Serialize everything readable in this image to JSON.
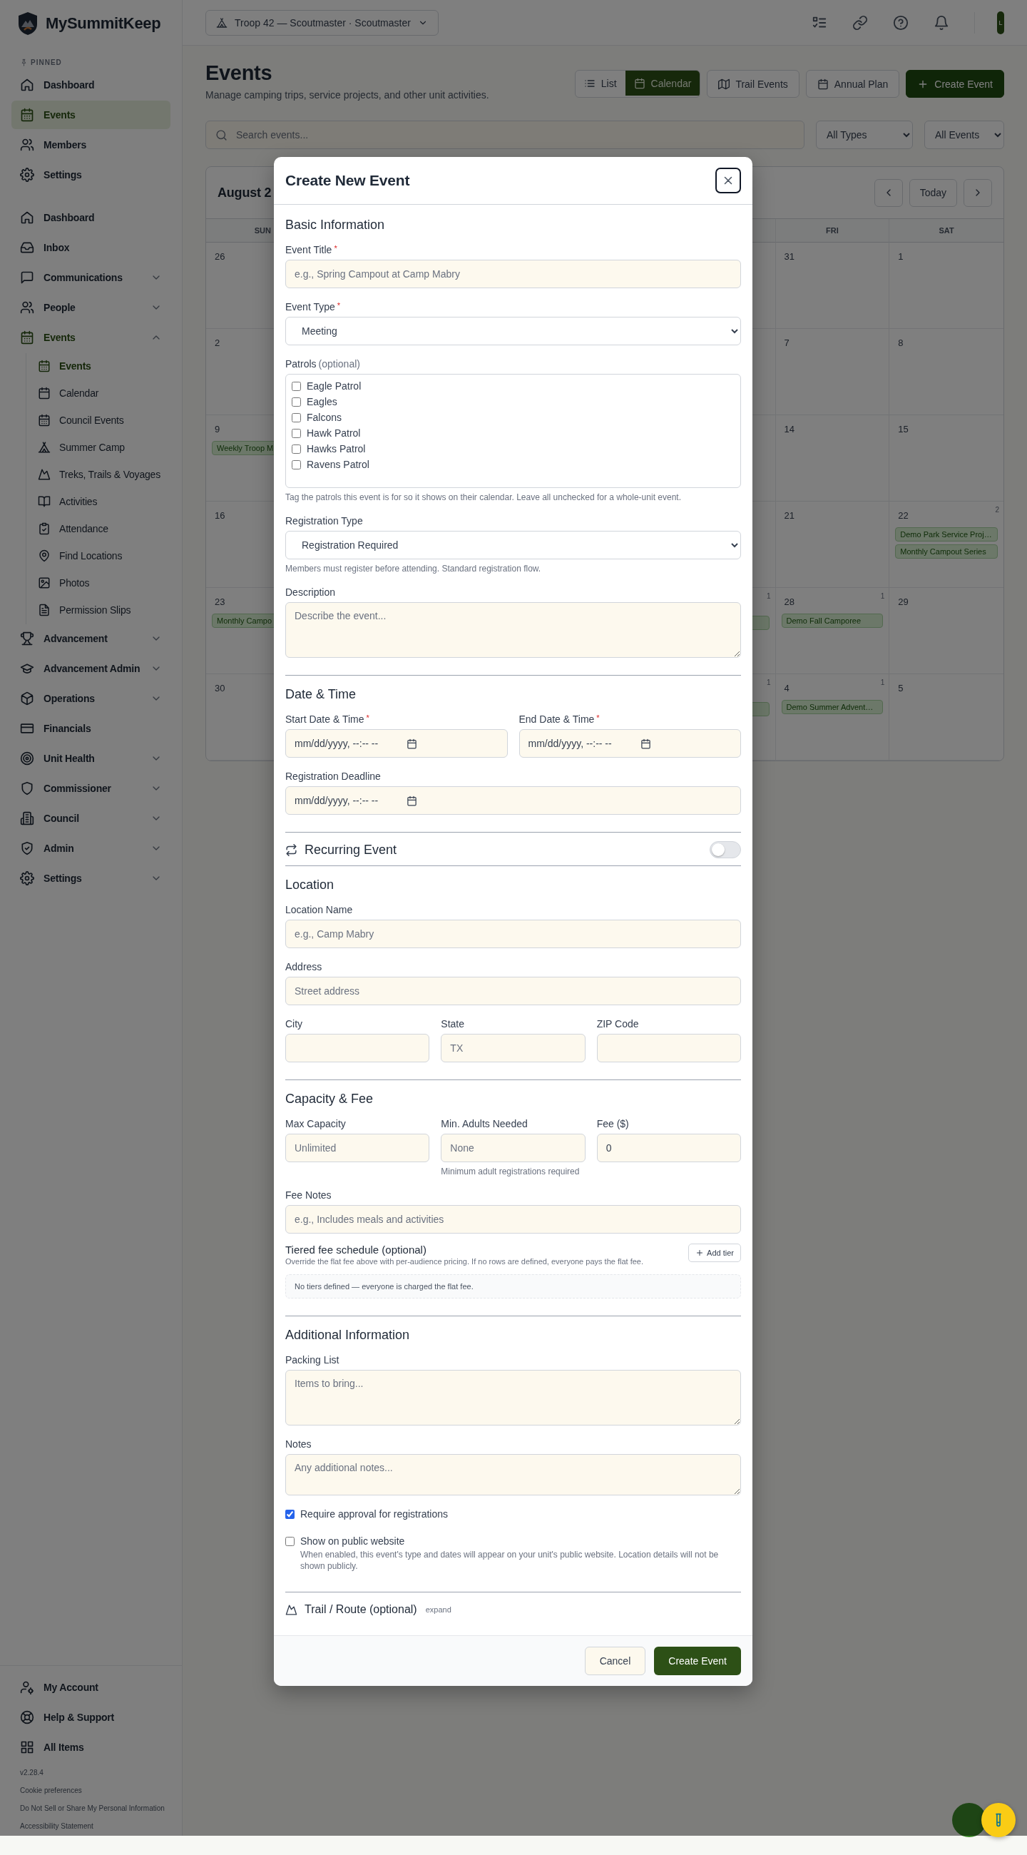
{
  "sidebar": {
    "brand": "MySummitKeep",
    "pinned_heading": "PINNED",
    "pinned": [
      {
        "label": "Dashboard",
        "selected": false
      },
      {
        "label": "Events",
        "selected": true
      },
      {
        "label": "Members",
        "selected": false
      },
      {
        "label": "Settings",
        "selected": false
      }
    ],
    "nav": [
      {
        "label": "Dashboard"
      },
      {
        "label": "Inbox"
      },
      {
        "label": "Communications",
        "expanded": false
      },
      {
        "label": "People",
        "expanded": false
      },
      {
        "label": "Events",
        "expanded": true,
        "children": [
          {
            "label": "Events",
            "selected": true
          },
          {
            "label": "Calendar",
            "selected": false
          },
          {
            "label": "Council Events",
            "selected": false
          },
          {
            "label": "Summer Camp",
            "selected": false
          },
          {
            "label": "Treks, Trails & Voyages",
            "selected": false
          },
          {
            "label": "Activities",
            "selected": false
          },
          {
            "label": "Attendance",
            "selected": false
          },
          {
            "label": "Find Locations",
            "selected": false
          },
          {
            "label": "Photos",
            "selected": false
          },
          {
            "label": "Permission Slips",
            "selected": false
          }
        ]
      },
      {
        "label": "Advancement",
        "expanded": false
      },
      {
        "label": "Advancement Admin",
        "expanded": false
      },
      {
        "label": "Operations",
        "expanded": false
      },
      {
        "label": "Financials"
      },
      {
        "label": "Unit Health",
        "expanded": false
      },
      {
        "label": "Commissioner",
        "expanded": false
      },
      {
        "label": "Council",
        "expanded": false
      },
      {
        "label": "Admin",
        "expanded": false
      },
      {
        "label": "Settings",
        "expanded": false
      }
    ],
    "footer_nav": [
      {
        "label": "My Account"
      },
      {
        "label": "Help & Support"
      },
      {
        "label": "All Items"
      }
    ],
    "version": "v2.28.4",
    "links": [
      "Cookie preferences",
      "Do Not Sell or Share My Personal Information",
      "Accessibility Statement"
    ]
  },
  "header": {
    "unit_selector": "Troop 42 — Scoutmaster · Scoutmaster",
    "avatar": "L"
  },
  "page": {
    "title": "Events",
    "subtitle": "Manage camping trips, service projects, and other unit activities.",
    "view_toggle": [
      {
        "label": "List",
        "selected": false
      },
      {
        "label": "Calendar",
        "selected": true
      }
    ],
    "buttons": [
      "Trail Events",
      "Annual Plan"
    ],
    "primary_button": "Create Event",
    "search": {
      "placeholder": "Search events..."
    },
    "filters": [
      "All Types",
      "All Events"
    ],
    "calendar": {
      "month_title": "August 2",
      "today_button": "Today",
      "weekdays": {
        "sun": "SUN",
        "fri": "FRI",
        "sat": "SAT"
      },
      "weeks": [
        {
          "sun": {
            "date": "26"
          },
          "fri": {
            "date": "31"
          },
          "sat": {
            "date": "1"
          }
        },
        {
          "sun": {
            "date": "2"
          },
          "fri": {
            "date": "7"
          },
          "sat": {
            "date": "8"
          }
        },
        {
          "sun": {
            "date": "9",
            "events": [
              {
                "kind": "event",
                "title": "Weekly Troop M"
              }
            ]
          },
          "fri": {
            "date": "14"
          },
          "sat": {
            "date": "15"
          }
        },
        {
          "sun": {
            "date": "16"
          },
          "fri": {
            "date": "21"
          },
          "sat": {
            "date": "22",
            "count": "2",
            "events": [
              {
                "kind": "event",
                "title": "Demo Park Service Proj…"
              },
              {
                "kind": "event",
                "title": "Monthly Campout Series"
              }
            ]
          }
        },
        {
          "sun": {
            "date": "23",
            "events": [
              {
                "kind": "event",
                "title": "Monthly Campo"
              }
            ]
          },
          "thu": {
            "count": "1",
            "events": [
              {
                "kind": "covered"
              }
            ]
          },
          "fri": {
            "date": "28",
            "count": "1",
            "events": [
              {
                "kind": "event",
                "title": "Demo Fall Camporee"
              }
            ]
          },
          "sat": {
            "date": "29"
          }
        },
        {
          "sun": {
            "date": "30"
          },
          "thu": {
            "count": "1",
            "events": [
              {
                "kind": "covered"
              }
            ]
          },
          "fri": {
            "date": "4",
            "count": "1",
            "events": [
              {
                "kind": "event",
                "title": "Demo Summer Advent…"
              }
            ]
          },
          "sat": {
            "date": "5"
          }
        }
      ]
    }
  },
  "modal": {
    "title": "Create New Event",
    "sections": [
      {
        "kind": "fields",
        "title": "Basic Information",
        "rows": [
          [
            {
              "kind": "text",
              "label": "Event Title",
              "required_mark": "*",
              "placeholder": "e.g., Spring Campout at Camp Mabry"
            }
          ],
          [
            {
              "kind": "select",
              "label": "Event Type",
              "required_mark": "*",
              "value": "Meeting"
            }
          ],
          [
            {
              "kind": "checklist",
              "label": "Patrols",
              "label_note": "(optional)",
              "options": [
                {
                  "label": "Eagle Patrol",
                  "checked": false
                },
                {
                  "label": "Eagles",
                  "checked": false
                },
                {
                  "label": "Falcons",
                  "checked": false
                },
                {
                  "label": "Hawk Patrol",
                  "checked": false
                },
                {
                  "label": "Hawks Patrol",
                  "checked": false
                },
                {
                  "label": "Ravens Patrol",
                  "checked": false
                }
              ],
              "hint": "Tag the patrols this event is for so it shows on their calendar. Leave all unchecked for a whole-unit event."
            }
          ],
          [
            {
              "kind": "select",
              "label": "Registration Type",
              "value": "Registration Required",
              "hint": "Members must register before attending. Standard registration flow."
            }
          ],
          [
            {
              "kind": "textarea",
              "label": "Description",
              "placeholder": "Describe the event..."
            }
          ]
        ]
      },
      {
        "kind": "fields",
        "title": "Date & Time",
        "rows": [
          [
            {
              "kind": "datetime",
              "label": "Start Date & Time",
              "required_mark": "*",
              "placeholder": "mm/dd/yyyy, --:-- --"
            },
            {
              "kind": "datetime",
              "label": "End Date & Time",
              "required_mark": "*",
              "placeholder": "mm/dd/yyyy, --:-- --"
            }
          ],
          [
            {
              "kind": "datetime",
              "label": "Registration Deadline",
              "placeholder": "mm/dd/yyyy, --:-- --"
            }
          ]
        ]
      },
      {
        "kind": "toggle",
        "title": "Recurring Event",
        "on": false
      },
      {
        "kind": "fields",
        "title": "Location",
        "rows": [
          [
            {
              "kind": "text",
              "label": "Location Name",
              "placeholder": "e.g., Camp Mabry"
            }
          ],
          [
            {
              "kind": "text",
              "label": "Address",
              "placeholder": "Street address"
            }
          ],
          [
            {
              "kind": "text",
              "label": "City"
            },
            {
              "kind": "text",
              "label": "State",
              "placeholder": "TX"
            },
            {
              "kind": "text",
              "label": "ZIP Code"
            }
          ]
        ]
      },
      {
        "kind": "fields",
        "title": "Capacity & Fee",
        "rows": [
          [
            {
              "kind": "text",
              "label": "Max Capacity",
              "placeholder": "Unlimited"
            },
            {
              "kind": "text",
              "label": "Min. Adults Needed",
              "placeholder": "None",
              "hint": "Minimum adult registrations required"
            },
            {
              "kind": "text",
              "label": "Fee ($)",
              "value": "0"
            }
          ],
          [
            {
              "kind": "text",
              "label": "Fee Notes",
              "placeholder": "e.g., Includes meals and activities"
            }
          ]
        ],
        "tiers": {
          "title": "Tiered fee schedule (optional)",
          "description": "Override the flat fee above with per-audience pricing. If no rows are defined, everyone pays the flat fee.",
          "button": "Add tier",
          "empty": "No tiers defined — everyone is charged the flat fee."
        }
      },
      {
        "kind": "fields",
        "title": "Additional Information",
        "rows": [
          [
            {
              "kind": "textarea",
              "label": "Packing List",
              "placeholder": "Items to bring..."
            }
          ],
          [
            {
              "kind": "textarea",
              "label": "Notes",
              "placeholder": "Any additional notes..."
            }
          ]
        ],
        "checks": [
          {
            "label": "Require approval for registrations",
            "checked": true
          },
          {
            "label": "Show on public website",
            "checked": false,
            "hint": "When enabled, this event's type and dates will appear on your unit's public website. Location details will not be shown publicly."
          }
        ]
      },
      {
        "kind": "collapsible",
        "title": "Trail / Route (optional)",
        "action": "expand"
      }
    ],
    "buttons": [
      {
        "kind": "secondary",
        "label": "Cancel"
      },
      {
        "kind": "primary",
        "label": "Create Event"
      }
    ]
  }
}
